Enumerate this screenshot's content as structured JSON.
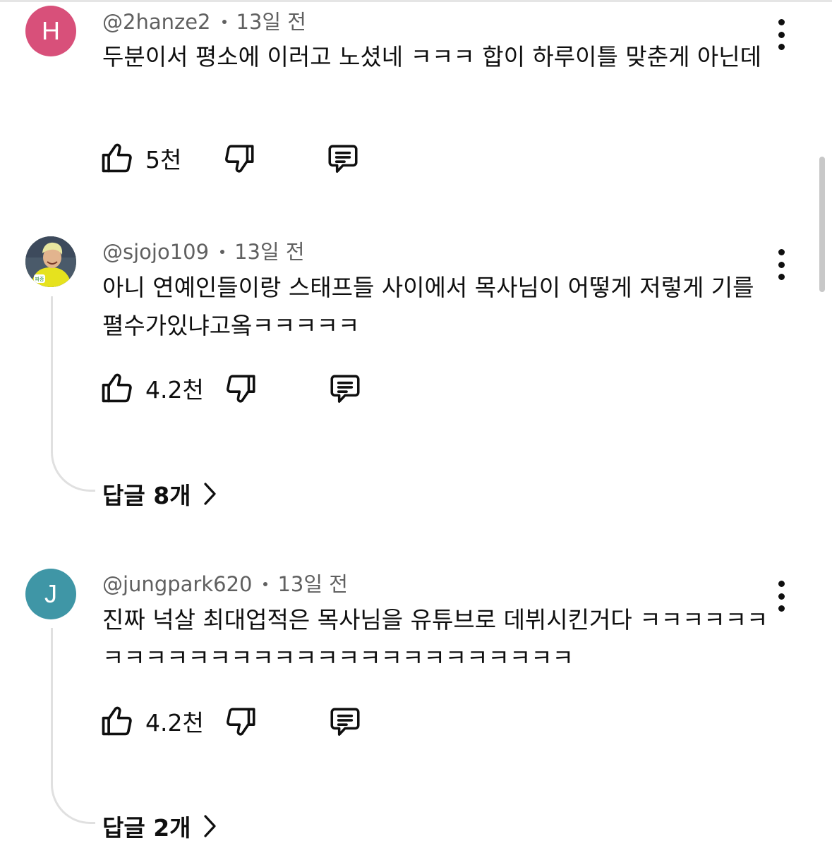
{
  "comments": [
    {
      "avatar_letter": "H",
      "avatar_color": "#d8507a",
      "author": "@2hanze2",
      "time": "13일 전",
      "text": "두분이서 평소에 이러고 노셨네 ㅋㅋㅋ 합이 하루이틀 맞춘게 아닌데",
      "likes": "5천",
      "replies_label": ""
    },
    {
      "avatar_letter": "",
      "avatar_color": "#6b7a3e",
      "author": "@sjojo109",
      "time": "13일 전",
      "text": "아니 연예인들이랑 스태프들 사이에서 목사님이 어떻게 저렇게 기를 펼수가있냐고옼ㅋㅋㅋㅋㅋ",
      "likes": "4.2천",
      "replies_label": "답글 8개"
    },
    {
      "avatar_letter": "J",
      "avatar_color": "#3f96a6",
      "author": "@jungpark620",
      "time": "13일 전",
      "text": "진짜 넉살 최대업적은 목사님을 유튜브로 데뷔시킨거다 ㅋㅋㅋㅋㅋㅋㅋㅋㅋㅋㅋㅋㅋㅋㅋㅋㅋㅋㅋㅋㅋㅋㅋㅋㅋㅋㅋㅋ",
      "likes": "4.2천",
      "replies_label": "답글 2개"
    }
  ],
  "icons": {
    "like": "thumbs-up-icon",
    "dislike": "thumbs-down-icon",
    "reply": "comment-icon",
    "more": "more-vert-icon",
    "chevron": "chevron-right-icon"
  }
}
